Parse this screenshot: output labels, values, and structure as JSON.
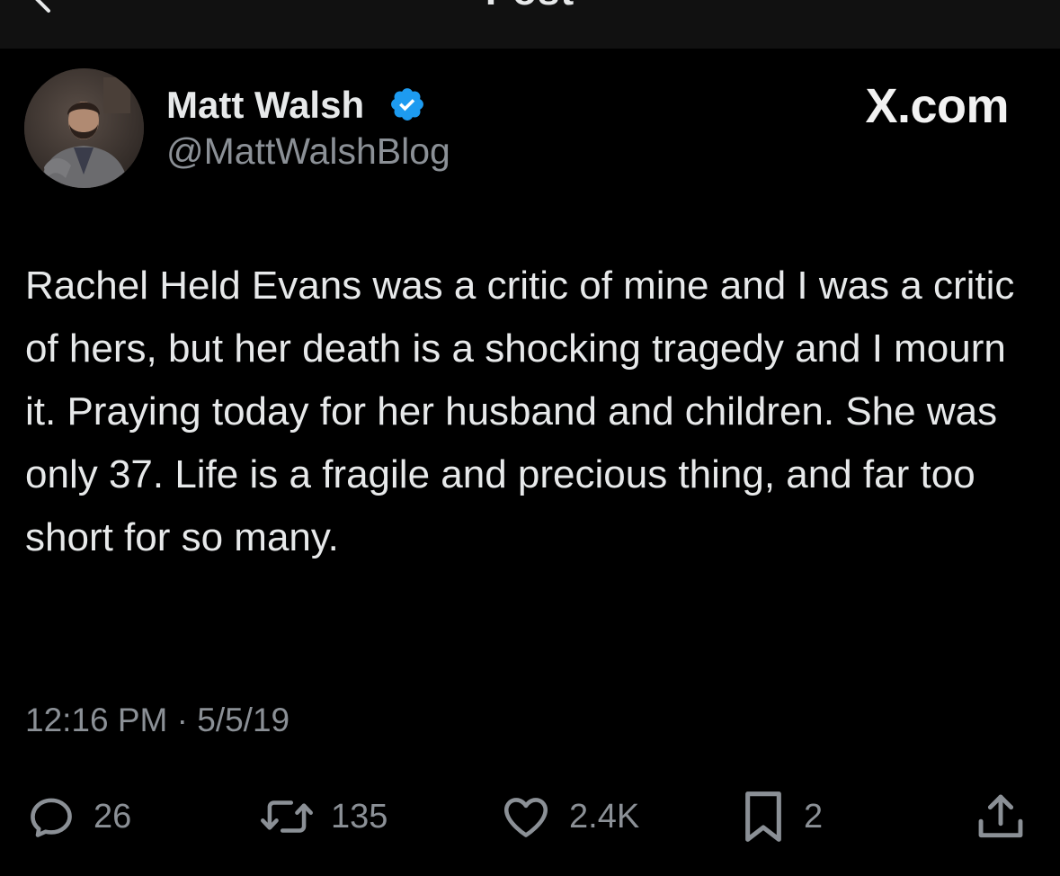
{
  "header": {
    "title": "Post",
    "back_icon": "arrow-left-icon"
  },
  "post": {
    "author_name": "Matt Walsh",
    "verified": true,
    "verified_icon": "verified-badge-icon",
    "handle": "@MattWalshBlog",
    "brand": "X.com",
    "text": "Rachel Held Evans was a critic of mine and I was a critic of hers, but her death is a shocking tragedy and I mourn it. Praying today for her husband and children. She was only 37. Life is a fragile and precious thing, and far too short for so many.",
    "timestamp": "12:16 PM · 5/5/19"
  },
  "actions": {
    "replies": {
      "icon": "reply-icon",
      "count": "26"
    },
    "reposts": {
      "icon": "repost-icon",
      "count": "135"
    },
    "likes": {
      "icon": "heart-icon",
      "count": "2.4K"
    },
    "bookmarks": {
      "icon": "bookmark-icon",
      "count": "2"
    },
    "share": {
      "icon": "share-icon"
    }
  },
  "colors": {
    "background": "#000000",
    "text_primary": "#e7e9ea",
    "text_secondary": "#8b9096",
    "verified_blue": "#1d9bf0"
  }
}
